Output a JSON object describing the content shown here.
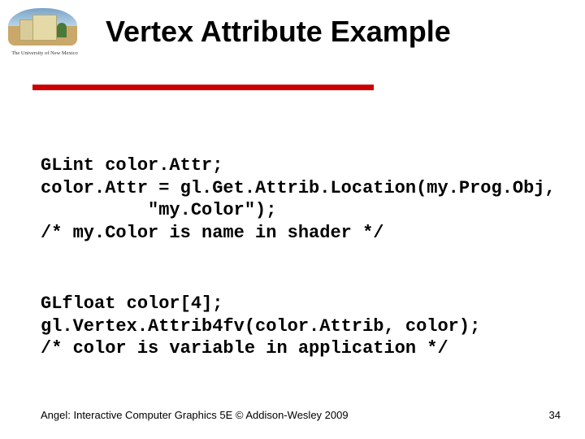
{
  "logo": {
    "caption": "The University of New Mexico"
  },
  "title": "Vertex Attribute Example",
  "code": {
    "block1": "GLint color.Attr;\ncolor.Attr = gl.Get.Attrib.Location(my.Prog.Obj,\n          \"my.Color\");\n/* my.Color is name in shader */",
    "block2": "GLfloat color[4];\ngl.Vertex.Attrib4fv(color.Attrib, color);\n/* color is variable in application */"
  },
  "footer": "Angel: Interactive Computer Graphics 5E © Addison-Wesley 2009",
  "page_number": "34"
}
